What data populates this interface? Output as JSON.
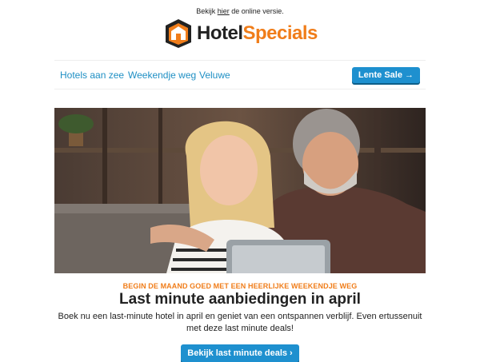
{
  "header": {
    "preview_prefix": "Bekijk",
    "preview_link": "hier",
    "preview_suffix": "de online versie.",
    "logo_part1": "Hotel",
    "logo_part2": "Specials"
  },
  "nav": {
    "items": [
      {
        "label": "Hotels aan zee"
      },
      {
        "label": "Weekendje weg"
      },
      {
        "label": "Veluwe"
      }
    ],
    "sale_button": "Lente Sale →"
  },
  "hero": {
    "image_name": "couple-on-sofa-with-tablet"
  },
  "content": {
    "eyebrow": "BEGIN DE MAAND GOED MET EEN HEERLIJKE WEEKENDJE WEG",
    "headline": "Last minute aanbiedingen in april",
    "body": "Boek nu een last-minute hotel in april en geniet van een ontspannen verblijf. Even ertussenuit met deze last minute deals!",
    "cta": "Bekijk last minute deals ›"
  },
  "colors": {
    "accent_orange": "#f07d1a",
    "link_blue": "#1e8fc4",
    "button_blue": "#1e90cf"
  }
}
